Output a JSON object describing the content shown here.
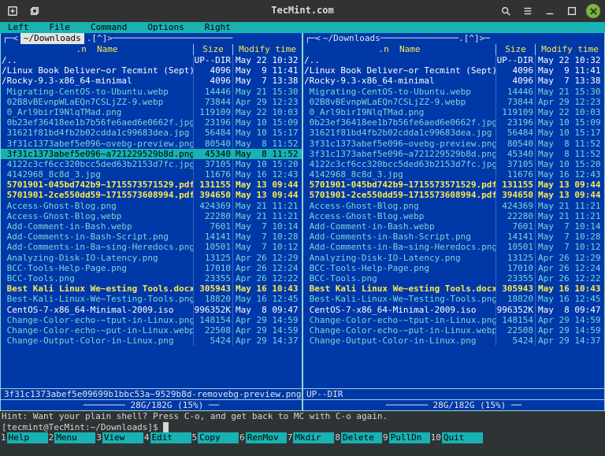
{
  "window": {
    "title": "TecMint.com"
  },
  "menu": [
    "Left",
    "File",
    "Command",
    "Options",
    "Right"
  ],
  "path_label": "~/Downloads",
  "columns": {
    "name": "Name",
    "size": "Size",
    "modify": "Modify time"
  },
  "left_selected_index": 9,
  "left_footer": "3f31c1373abef5e09699b1bbc53a~9529b8d-removebg-preview.png",
  "right_footer": "UP--DIR",
  "diskusage": "28G/182G (15%)",
  "hint": "Hint: Want your plain shell? Press C-o, and get back to MC with C-o again.",
  "prompt": "[tecmint@TecMint:~/Downloads]$ ",
  "fkeys": [
    {
      "n": "1",
      "l": "Help"
    },
    {
      "n": "2",
      "l": "Menu"
    },
    {
      "n": "3",
      "l": "View"
    },
    {
      "n": "4",
      "l": "Edit"
    },
    {
      "n": "5",
      "l": "Copy"
    },
    {
      "n": "6",
      "l": "RenMov"
    },
    {
      "n": "7",
      "l": "Mkdir"
    },
    {
      "n": "8",
      "l": "Delete"
    },
    {
      "n": "9",
      "l": "PullDn"
    },
    {
      "n": "10",
      "l": "Quit"
    }
  ],
  "files": [
    {
      "name": "/..",
      "size": "UP--DIR",
      "mtime": "May 22 10:32",
      "cls": "c-dir"
    },
    {
      "name": "/Linux Book Deliver~or Tecmint (Sept)",
      "size": "4096",
      "mtime": "May  9 11:41",
      "cls": "c-dir"
    },
    {
      "name": "/Rocky-9.3-x86_64-minimal",
      "size": "4096",
      "mtime": "May  7 13:38",
      "cls": "c-dir"
    },
    {
      "name": " Migrating-CentOS-to-Ubuntu.webp",
      "size": "14446",
      "mtime": "May 21 15:30",
      "cls": "c-img"
    },
    {
      "name": " 02B8vBEvnpWLaEQn7CSLjZZ-9.webp",
      "size": "73844",
      "mtime": "Apr 29 12:23",
      "cls": "c-img"
    },
    {
      "name": " 0_Arl9birI9NlqTMad.png",
      "size": "119109",
      "mtime": "May 22 10:03",
      "cls": "c-img"
    },
    {
      "name": " 0b23ef36418ee1b7b56fe6aed6e0662f.jpg",
      "size": "23196",
      "mtime": "May 10 15:09",
      "cls": "c-img"
    },
    {
      "name": " 31621f81bd4fb2b02cdda1c99683dea.jpg",
      "size": "56484",
      "mtime": "May 10 15:17",
      "cls": "c-img"
    },
    {
      "name": " 3f31c1373abef5e096~ovebg-preview.png",
      "size": "80540",
      "mtime": "May  8 11:52",
      "cls": "c-img"
    },
    {
      "name": " 3f31c1373abef5e096~a721229529b8d.png",
      "size": "45340",
      "mtime": "May  8 11:52",
      "cls": "c-img"
    },
    {
      "name": " 4122c3cf6cc320bcc5ded63b2153d7fc.jpg",
      "size": "37105",
      "mtime": "May 10 15:20",
      "cls": "c-img"
    },
    {
      "name": " 4142968_8c8d_3.jpg",
      "size": "11676",
      "mtime": "May 16 12:43",
      "cls": "c-img"
    },
    {
      "name": " 5701901-045bd742b9~1715573571529.pdf",
      "size": "131155",
      "mtime": "May 13 09:44",
      "cls": "c-doc"
    },
    {
      "name": " 5701901-2ce550dd59~1715573608994.pdf",
      "size": "394650",
      "mtime": "May 13 09:44",
      "cls": "c-doc"
    },
    {
      "name": " Access-Ghost-Blog.png",
      "size": "424369",
      "mtime": "May 21 11:21",
      "cls": "c-img"
    },
    {
      "name": " Access-Ghost-Blog.webp",
      "size": "22280",
      "mtime": "May 21 11:21",
      "cls": "c-img"
    },
    {
      "name": " Add-Comment-in-Bash.webp",
      "size": "7601",
      "mtime": "May  7 10:14",
      "cls": "c-img"
    },
    {
      "name": " Add-Comments-in-Bash-Script.png",
      "size": "14141",
      "mtime": "May  7 10:28",
      "cls": "c-img"
    },
    {
      "name": " Add-Comments-in-Ba~sing-Heredocs.png",
      "size": "10501",
      "mtime": "May  7 10:12",
      "cls": "c-img"
    },
    {
      "name": " Analyzing-Disk-IO-Latency.png",
      "size": "13125",
      "mtime": "Apr 26 12:29",
      "cls": "c-img"
    },
    {
      "name": " BCC-Tools-Help-Page.png",
      "size": "17010",
      "mtime": "Apr 26 12:24",
      "cls": "c-img"
    },
    {
      "name": " BCC-Tools.png",
      "size": "23355",
      "mtime": "Apr 26 12:22",
      "cls": "c-img"
    },
    {
      "name": " Best Kali Linux We~esting Tools.docx",
      "size": "305943",
      "mtime": "May 16 10:43",
      "cls": "c-doc"
    },
    {
      "name": " Best-Kali-Linux-We~Testing-Tools.png",
      "size": "18820",
      "mtime": "May 16 12:45",
      "cls": "c-img"
    },
    {
      "name": " CentOS-7-x86_64-Minimal-2009.iso",
      "size": "996352K",
      "mtime": "May  8 09:47",
      "cls": "c-dir"
    },
    {
      "name": " Change-Color-echo-~tput-in-Linux.png",
      "size": "148154",
      "mtime": "Apr 29 14:59",
      "cls": "c-img"
    },
    {
      "name": " Change-Color-echo-~put-in-Linux.webp",
      "size": "22508",
      "mtime": "Apr 29 14:59",
      "cls": "c-img"
    },
    {
      "name": " Change-Output-Color-in-Linux.png",
      "size": "5424",
      "mtime": "Apr 29 14:37",
      "cls": "c-img"
    }
  ]
}
